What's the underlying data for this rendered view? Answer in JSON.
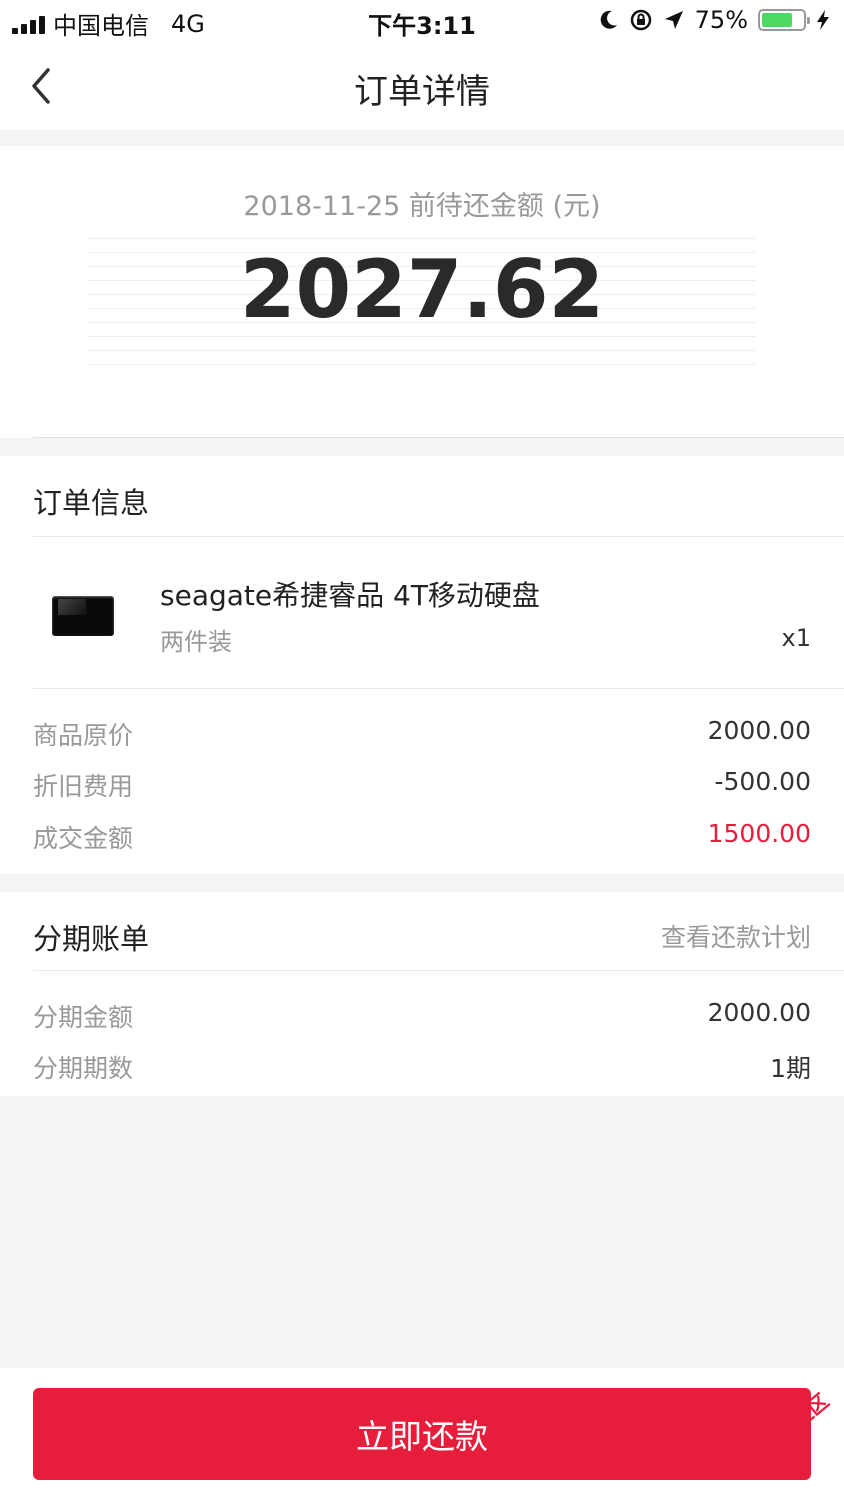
{
  "status_bar": {
    "carrier": "中国电信",
    "network": "4G",
    "time": "下午3:11",
    "battery_percent": "75%",
    "battery_level": 0.75
  },
  "nav": {
    "title": "订单详情",
    "back_icon": "chevron-left-icon"
  },
  "hero": {
    "subtitle": "2018-11-25 前待还金额 (元)",
    "amount": "2027.62"
  },
  "order": {
    "title": "订单信息",
    "product": {
      "name": "seagate希捷睿品 4T移动硬盘",
      "spec": "两件装",
      "qty": "x1"
    },
    "rows": [
      {
        "label": "商品原价",
        "value": "2000.00"
      },
      {
        "label": "折旧费用",
        "value": "-500.00"
      },
      {
        "label": "成交金额",
        "value": "1500.00"
      }
    ]
  },
  "installment": {
    "title": "分期账单",
    "link": "查看还款计划",
    "rows": [
      {
        "label": "分期金额",
        "value": "2000.00"
      },
      {
        "label": "分期期数",
        "value": "1期"
      }
    ]
  },
  "action": {
    "pay_label": "立即还款"
  },
  "watermark": "卡农社区",
  "colors": {
    "accent": "#e61e3c",
    "battery": "#4cd964"
  }
}
